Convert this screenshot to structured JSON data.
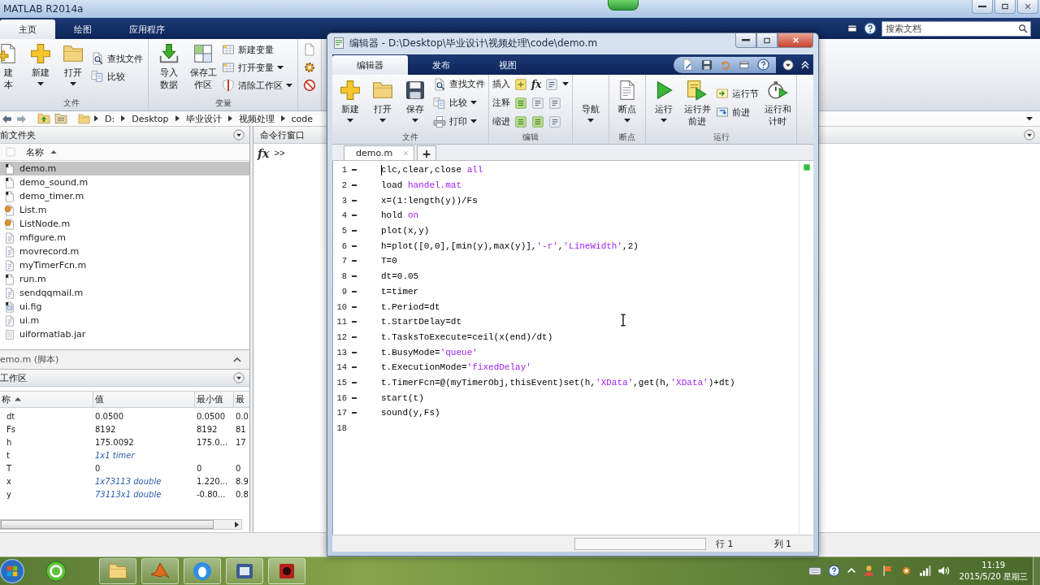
{
  "window": {
    "title": "MATLAB R2014a"
  },
  "tabs": [
    {
      "label": "主页",
      "selected": true
    },
    {
      "label": "绘图",
      "selected": false
    },
    {
      "label": "应用程序",
      "selected": false
    }
  ],
  "search": {
    "placeholder": "搜索文档"
  },
  "ribbon": {
    "groups": [
      {
        "label": "文件",
        "columns": [
          {
            "kind": "large",
            "label": "建本",
            "caret": false
          },
          {
            "kind": "large",
            "label": "新建",
            "caret": true
          },
          {
            "kind": "large",
            "label": "打开",
            "caret": true
          },
          {
            "kind": "stack",
            "items": [
              {
                "label": "查找文件",
                "caret": false
              },
              {
                "label": "比较",
                "caret": false
              }
            ]
          }
        ]
      },
      {
        "label": "变量",
        "columns": [
          {
            "kind": "large",
            "label": "导入数据",
            "caret": false
          },
          {
            "kind": "large",
            "label": "保存工作区",
            "caret": false
          },
          {
            "kind": "stack",
            "items": [
              {
                "label": "新建变量",
                "caret": false
              },
              {
                "label": "打开变量",
                "caret": true
              },
              {
                "label": "清除工作区",
                "caret": true
              }
            ]
          }
        ]
      }
    ]
  },
  "address_bar": {
    "path": [
      "D:",
      "Desktop",
      "毕业设计",
      "视频处理",
      "code"
    ]
  },
  "current_folder": {
    "title": "前文件夹",
    "column": "名称",
    "files": [
      {
        "name": "demo.m",
        "kind": "script",
        "selected": true
      },
      {
        "name": "demo_sound.m",
        "kind": "script",
        "selected": false
      },
      {
        "name": "demo_timer.m",
        "kind": "script",
        "selected": false
      },
      {
        "name": "List.m",
        "kind": "class",
        "selected": false
      },
      {
        "name": "ListNode.m",
        "kind": "class",
        "selected": false
      },
      {
        "name": "mfigure.m",
        "kind": "function",
        "selected": false
      },
      {
        "name": "movrecord.m",
        "kind": "function",
        "selected": false
      },
      {
        "name": "myTimerFcn.m",
        "kind": "function",
        "selected": false
      },
      {
        "name": "run.m",
        "kind": "script",
        "selected": false
      },
      {
        "name": "sendqqmail.m",
        "kind": "function",
        "selected": false
      },
      {
        "name": "ui.fig",
        "kind": "figure",
        "selected": false
      },
      {
        "name": "ui.m",
        "kind": "function",
        "selected": false
      },
      {
        "name": "uiformatlab.jar",
        "kind": "archive",
        "selected": false
      }
    ],
    "details": "emo.m (脚本)"
  },
  "workspace": {
    "title": "工作区",
    "columns": [
      "称",
      "值",
      "最小值",
      "最"
    ],
    "rows": [
      {
        "name": "dt",
        "kind": "scalar",
        "value": "0.0500",
        "min": "0.0500",
        "max": "0.0"
      },
      {
        "name": "Fs",
        "kind": "scalar",
        "value": "8192",
        "min": "8192",
        "max": "81"
      },
      {
        "name": "h",
        "kind": "scalar",
        "value": "175.0092",
        "min": "175.0...",
        "max": "17"
      },
      {
        "name": "t",
        "kind": "object",
        "value": "1x1 timer"
      },
      {
        "name": "T",
        "kind": "scalar",
        "value": "0",
        "min": "0",
        "max": "0"
      },
      {
        "name": "x",
        "kind": "object",
        "value": "1x73113 double",
        "min": "1.220...",
        "max": "8.9"
      },
      {
        "name": "y",
        "kind": "object",
        "value": "73113x1 double",
        "min": "-0.80...",
        "max": "0.8"
      }
    ]
  },
  "command_window": {
    "title": "命令行窗口",
    "function_button": "fx",
    "prompt": ">>"
  },
  "editor": {
    "title": "编辑器 - D:\\Desktop\\毕业设计\\视频处理\\code\\demo.m",
    "tabs": [
      {
        "label": "编辑器",
        "selected": true
      },
      {
        "label": "发布",
        "selected": false
      },
      {
        "label": "视图",
        "selected": false
      }
    ],
    "ribbon": {
      "groups": [
        {
          "label": "文件",
          "columns": [
            {
              "kind": "large",
              "label": "新建",
              "caret": true
            },
            {
              "kind": "large",
              "label": "打开",
              "caret": true
            },
            {
              "kind": "large",
              "label": "保存",
              "caret": true
            },
            {
              "kind": "stack",
              "items": [
                {
                  "label": "查找文件",
                  "caret": false
                },
                {
                  "label": "比较",
                  "caret": true
                },
                {
                  "label": "打印",
                  "caret": true
                }
              ]
            }
          ]
        },
        {
          "label": "编辑",
          "columns": [
            {
              "kind": "rows",
              "items": [
                {
                  "label": "插入",
                  "function_button": "fx",
                  "caret": true
                },
                {
                  "label": "注释",
                  "caret": false
                },
                {
                  "label": "缩进",
                  "caret": false
                }
              ]
            }
          ]
        },
        {
          "columns": [
            {
              "kind": "large",
              "label": "导航",
              "caret": true
            }
          ]
        },
        {
          "label": "断点",
          "columns": [
            {
              "kind": "large",
              "label": "断点",
              "caret": true
            }
          ]
        },
        {
          "label": "运行",
          "columns": [
            {
              "kind": "large",
              "label": "运行",
              "caret": true
            },
            {
              "kind": "large",
              "label": "运行并前进",
              "caret": false
            },
            {
              "kind": "stack",
              "items": [
                {
                  "label": "运行节",
                  "caret": false
                },
                {
                  "label": "前进",
                  "caret": false
                }
              ]
            },
            {
              "kind": "large",
              "label": "运行和计时",
              "caret": false
            }
          ]
        }
      ]
    },
    "documents": [
      {
        "name": "demo.m",
        "selected": true
      }
    ],
    "new_tab": "+",
    "lines": [
      {
        "number": "1",
        "executable": true,
        "cursor": true,
        "segments": [
          {
            "text": "clc,clear,close ",
            "kind": "code"
          },
          {
            "text": "all",
            "kind": "string"
          }
        ]
      },
      {
        "number": "2",
        "executable": true,
        "cursor": false,
        "segments": [
          {
            "text": "load ",
            "kind": "code"
          },
          {
            "text": "handel.mat",
            "kind": "string"
          }
        ]
      },
      {
        "number": "3",
        "executable": true,
        "cursor": false,
        "segments": [
          {
            "text": "x=(1:length(y))/Fs",
            "kind": "code"
          }
        ]
      },
      {
        "number": "4",
        "executable": true,
        "cursor": false,
        "segments": [
          {
            "text": "hold ",
            "kind": "code"
          },
          {
            "text": "on",
            "kind": "string"
          }
        ]
      },
      {
        "number": "5",
        "executable": true,
        "cursor": false,
        "segments": [
          {
            "text": "plot(x,y)",
            "kind": "code"
          }
        ]
      },
      {
        "number": "6",
        "executable": true,
        "cursor": false,
        "segments": [
          {
            "text": "h=plot([0,0],[min(y),max(y)],",
            "kind": "code"
          },
          {
            "text": "'-r'",
            "kind": "string"
          },
          {
            "text": ",",
            "kind": "code"
          },
          {
            "text": "'LineWidth'",
            "kind": "string"
          },
          {
            "text": ",2)",
            "kind": "code"
          }
        ]
      },
      {
        "number": "7",
        "executable": true,
        "cursor": false,
        "segments": [
          {
            "text": "T=0",
            "kind": "code"
          }
        ]
      },
      {
        "number": "8",
        "executable": true,
        "cursor": false,
        "segments": [
          {
            "text": "dt=0.05",
            "kind": "code"
          }
        ]
      },
      {
        "number": "9",
        "executable": true,
        "cursor": false,
        "segments": [
          {
            "text": "t=timer",
            "kind": "code"
          }
        ]
      },
      {
        "number": "10",
        "executable": true,
        "cursor": false,
        "segments": [
          {
            "text": "t.Period=dt",
            "kind": "code"
          }
        ]
      },
      {
        "number": "11",
        "executable": true,
        "cursor": false,
        "segments": [
          {
            "text": "t.StartDelay=dt",
            "kind": "code"
          }
        ]
      },
      {
        "number": "12",
        "executable": true,
        "cursor": false,
        "segments": [
          {
            "text": "t.TasksToExecute=ceil(x(end)/dt)",
            "kind": "code"
          }
        ]
      },
      {
        "number": "13",
        "executable": true,
        "cursor": false,
        "segments": [
          {
            "text": "t.BusyMode=",
            "kind": "code"
          },
          {
            "text": "'queue'",
            "kind": "string"
          }
        ]
      },
      {
        "number": "14",
        "executable": true,
        "cursor": false,
        "segments": [
          {
            "text": "t.ExecutionMode=",
            "kind": "code"
          },
          {
            "text": "'fixedDelay'",
            "kind": "string"
          }
        ]
      },
      {
        "number": "15",
        "executable": true,
        "cursor": false,
        "segments": [
          {
            "text": "t.TimerFcn=@(myTimerObj,thisEvent)set(h,",
            "kind": "code"
          },
          {
            "text": "'XData'",
            "kind": "string"
          },
          {
            "text": ",get(h,",
            "kind": "code"
          },
          {
            "text": "'XData'",
            "kind": "string"
          },
          {
            "text": ")+dt)",
            "kind": "code"
          }
        ]
      },
      {
        "number": "16",
        "executable": true,
        "cursor": false,
        "segments": [
          {
            "text": "start(t)",
            "kind": "code"
          }
        ]
      },
      {
        "number": "17",
        "executable": true,
        "cursor": false,
        "segments": [
          {
            "text": "sound(y,Fs)",
            "kind": "code"
          }
        ]
      },
      {
        "number": "18",
        "executable": false,
        "cursor": false
      }
    ],
    "status": {
      "line": "行 1",
      "column": "列 1"
    }
  },
  "taskbar": {
    "time": "11:19",
    "date": "2015/5/20 星期三"
  }
}
